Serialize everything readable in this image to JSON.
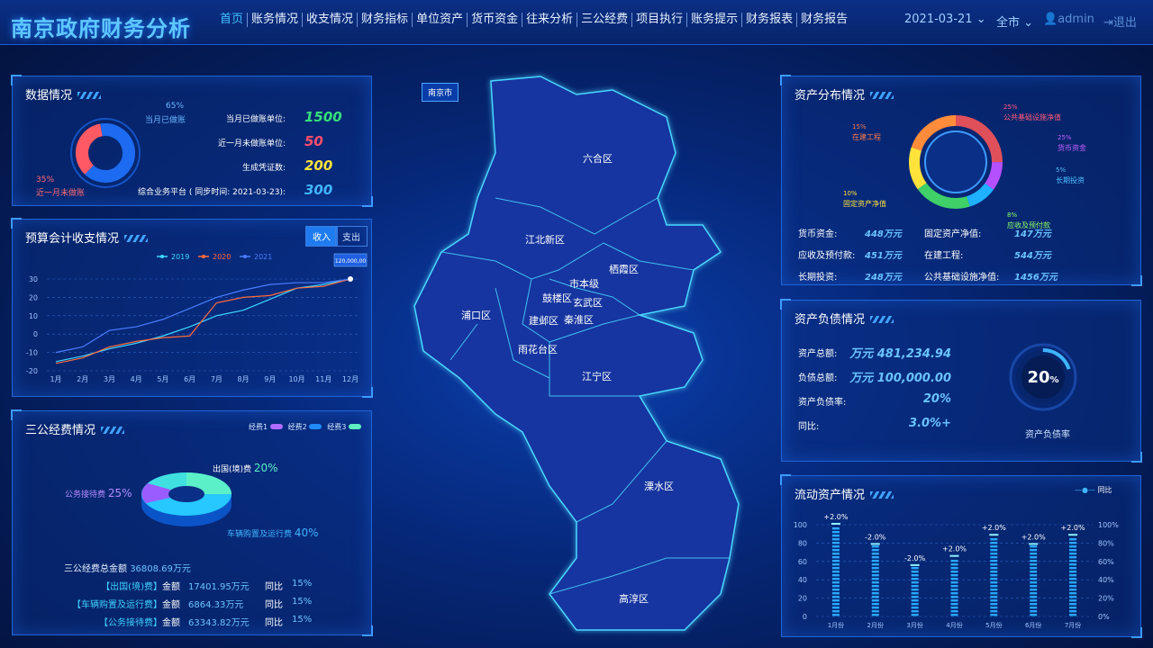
{
  "header": {
    "title": "南京政府财务分析",
    "nav": [
      "首页",
      "账务情况",
      "收支情况",
      "财务指标",
      "单位资产",
      "货币资金",
      "往来分析",
      "三公经费",
      "项目执行",
      "账务提示",
      "财务报表",
      "财务报告"
    ],
    "date": "2021-03-21",
    "region": "全市",
    "user": "admin",
    "logout": "退出"
  },
  "data_panel": {
    "title": "数据情况",
    "pct_done": "65%",
    "lbl_done": "当月已做账",
    "pct_not": "35%",
    "lbl_not": "近一月未做账",
    "rows": [
      {
        "label": "当月已做账单位:",
        "value": "1500",
        "color": "#37e07a"
      },
      {
        "label": "近一月未做账单位:",
        "value": "50",
        "color": "#ff4e6a"
      },
      {
        "label": "生成凭证数:",
        "value": "200",
        "color": "#ffe23a"
      },
      {
        "label": "综合业务平台 ( 同步时间: 2021-03-23):",
        "value": "300",
        "color": "#41b6ff"
      }
    ]
  },
  "budget_panel": {
    "title": "预算会计收支情况",
    "tab_income": "收入",
    "tab_expense": "支出",
    "tooltip": "120,000,00"
  },
  "chart_data": {
    "type": "line",
    "categories": [
      "1月",
      "2月",
      "3月",
      "4月",
      "5月",
      "6月",
      "7月",
      "8月",
      "9月",
      "10月",
      "11月",
      "12月"
    ],
    "ylim": [
      -20,
      30
    ],
    "yticks": [
      -20,
      -10,
      0,
      10,
      20,
      30
    ],
    "series": [
      {
        "name": "2019",
        "color": "#3fd7ff",
        "values": [
          -15,
          -12,
          -8,
          -5,
          -1,
          4,
          10,
          13,
          19,
          25,
          27,
          30
        ]
      },
      {
        "name": "2020",
        "color": "#ff6a3a",
        "values": [
          -16,
          -13,
          -7,
          -4,
          -2,
          -1,
          17,
          20,
          21,
          25,
          26,
          30
        ]
      },
      {
        "name": "2021",
        "color": "#4a7dff",
        "values": [
          -10,
          -7,
          2,
          4,
          8,
          14,
          20,
          24,
          27,
          28,
          28,
          30
        ]
      }
    ]
  },
  "sangong_panel": {
    "title": "三公经费情况",
    "legend": [
      "经费1",
      "经费2",
      "经费3"
    ],
    "seg_abroad": "出国(境)费",
    "seg_abroad_pct": "20%",
    "seg_recept": "公务接待费",
    "seg_recept_pct": "25%",
    "seg_car": "车辆购置及运行费",
    "seg_car_pct": "40%",
    "total_label": "三公经费总金额",
    "total_value": "36808.69万元",
    "rows": [
      {
        "name": "【出国(境)费】",
        "amt_lbl": "金额",
        "amt": "17401.95万元",
        "yoy_lbl": "同比",
        "yoy": "15%"
      },
      {
        "name": "【车辆购置及运行费】",
        "amt_lbl": "金额",
        "amt": "6864.33万元",
        "yoy_lbl": "同比",
        "yoy": "15%"
      },
      {
        "name": "【公务接待费】",
        "amt_lbl": "金额",
        "amt": "63343.82万元",
        "yoy_lbl": "同比",
        "yoy": "15%"
      }
    ]
  },
  "map": {
    "city": "南京市",
    "districts": [
      "六合区",
      "江北新区",
      "栖霞区",
      "浦口区",
      "市本级",
      "鼓楼区",
      "玄武区",
      "建邺区",
      "秦淮区",
      "雨花台区",
      "江宁区",
      "溧水区",
      "高淳区"
    ]
  },
  "asset_panel": {
    "title": "资产分布情况",
    "pie": [
      {
        "pct": "25%",
        "label": "公共基础设施净值"
      },
      {
        "pct": "25%",
        "label": "货币资金"
      },
      {
        "pct": "5%",
        "label": "长期投资"
      },
      {
        "pct": "8%",
        "label": "应收及预付款"
      },
      {
        "pct": "10%",
        "label": "固定资产净值"
      },
      {
        "pct": "15%",
        "label": "在建工程"
      }
    ],
    "rows": [
      {
        "l": "货币资金:",
        "v": "448万元",
        "l2": "固定资产净值:",
        "v2": "147万元"
      },
      {
        "l": "应收及预付款:",
        "v": "451万元",
        "l2": "在建工程:",
        "v2": "544万元"
      },
      {
        "l": "长期投资:",
        "v": "248万元",
        "l2": "公共基础设施净值:",
        "v2": "1456万元"
      }
    ]
  },
  "liability_panel": {
    "title": "资产负债情况",
    "rows": [
      {
        "l": "资产总额:",
        "v": "481,234.94 万元"
      },
      {
        "l": "负债总额:",
        "v": "100,000.00 万元"
      },
      {
        "l": "资产负债率:",
        "v": "20%"
      },
      {
        "l": "同比:",
        "v": "+3.0%"
      }
    ],
    "gauge_value": "20",
    "gauge_unit": "%",
    "gauge_label": "资产负债率"
  },
  "current_panel": {
    "title": "流动资产情况",
    "legend": "同比",
    "yleft": [
      "100",
      "80",
      "60",
      "40",
      "20",
      "0"
    ],
    "yright": [
      "100%",
      "80%",
      "60%",
      "40%",
      "20%",
      "0%"
    ],
    "bars": [
      {
        "m": "1月份",
        "v": 100,
        "t": "+2.0%"
      },
      {
        "m": "2月份",
        "v": 78,
        "t": "-2.0%"
      },
      {
        "m": "3月份",
        "v": 55,
        "t": "-2.0%"
      },
      {
        "m": "4月份",
        "v": 65,
        "t": "+2.0%"
      },
      {
        "m": "5月份",
        "v": 88,
        "t": "+2.0%"
      },
      {
        "m": "6月份",
        "v": 78,
        "t": "+2.0%"
      },
      {
        "m": "7月份",
        "v": 88,
        "t": "+2.0%"
      }
    ]
  }
}
